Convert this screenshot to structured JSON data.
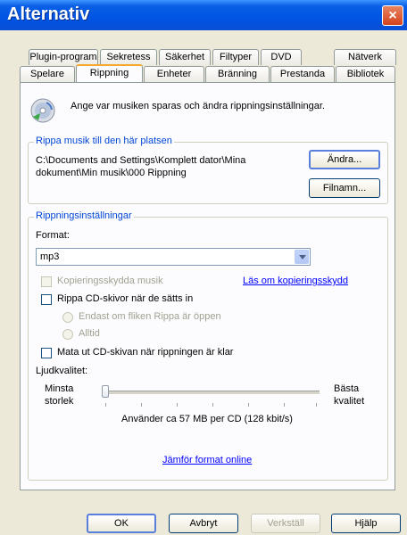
{
  "window": {
    "title": "Alternativ",
    "close": "×"
  },
  "tabs_back": [
    {
      "label": "Plugin-program"
    },
    {
      "label": "Sekretess"
    },
    {
      "label": "Säkerhet"
    },
    {
      "label": "Filtyper"
    },
    {
      "label": "DVD"
    },
    {
      "label": "Nätverk"
    }
  ],
  "tabs_front": [
    {
      "label": "Spelare"
    },
    {
      "label": "Rippning",
      "active": true
    },
    {
      "label": "Enheter"
    },
    {
      "label": "Bränning"
    },
    {
      "label": "Prestanda"
    },
    {
      "label": "Bibliotek"
    }
  ],
  "header": {
    "description": "Ange var musiken sparas och ändra rippningsinställningar."
  },
  "location_group": {
    "label": "Rippa musik till den här platsen",
    "path_line1": "C:\\Documents and Settings\\Komplett dator\\Mina",
    "path_line2": "dokument\\Min musik\\000 Rippning",
    "change_button": "Ändra...",
    "filename_button": "Filnamn..."
  },
  "settings_group": {
    "label": "Rippningsinställningar",
    "format_label": "Format:",
    "format_value": "mp3",
    "copy_protect": {
      "label": "Kopieringsskydda musik",
      "checked": false,
      "enabled": false
    },
    "copy_protect_link": "Läs om kopieringsskydd",
    "rip_on_insert": {
      "label": "Rippa CD-skivor när de sätts in",
      "checked": false
    },
    "radio_only_tab": "Endast om fliken Rippa är öppen",
    "radio_always": "Alltid",
    "eject_after": {
      "label": "Mata ut CD-skivan när rippningen är klar",
      "checked": false
    },
    "quality_label": "Ljudkvalitet:",
    "min_label_1": "Minsta",
    "min_label_2": "storlek",
    "max_label_1": "Bästa",
    "max_label_2": "kvalitet",
    "quality_level": 0,
    "usage_text": "Använder ca 57 MB per CD (128 kbit/s)",
    "compare_link": "Jämför format online"
  },
  "footer": {
    "ok": "OK",
    "cancel": "Avbryt",
    "apply": "Verkställ",
    "help": "Hjälp"
  }
}
